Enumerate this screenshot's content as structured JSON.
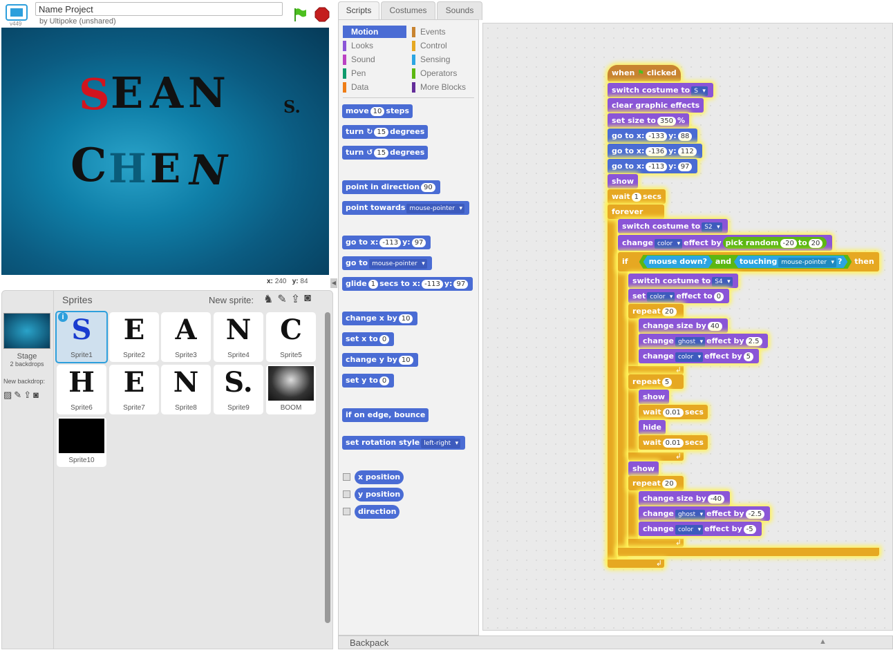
{
  "header": {
    "version": "v449",
    "project_title": "Name Project",
    "author": "by Ultipoke (unshared)"
  },
  "stage": {
    "mouse_x_label": "x:",
    "mouse_x": "240",
    "mouse_y_label": "y:",
    "mouse_y": "84",
    "letters": [
      "S",
      "E",
      "A",
      "N",
      "S.",
      "C",
      "H",
      "E",
      "N"
    ]
  },
  "sprites_pane": {
    "header": "Sprites",
    "new_sprite": "New sprite:",
    "stage_label": "Stage",
    "stage_sub": "2 backdrops",
    "new_backdrop": "New backdrop:",
    "tiles": [
      {
        "glyph": "S",
        "label": "Sprite1"
      },
      {
        "glyph": "E",
        "label": "Sprite2"
      },
      {
        "glyph": "A",
        "label": "Sprite3"
      },
      {
        "glyph": "N",
        "label": "Sprite4"
      },
      {
        "glyph": "C",
        "label": "Sprite5"
      },
      {
        "glyph": "H",
        "label": "Sprite6"
      },
      {
        "glyph": "E",
        "label": "Sprite7"
      },
      {
        "glyph": "N",
        "label": "Sprite8"
      },
      {
        "glyph": "S.",
        "label": "Sprite9"
      },
      {
        "glyph": "",
        "label": "BOOM"
      },
      {
        "glyph": "",
        "label": "Sprite10"
      }
    ]
  },
  "tabs": [
    "Scripts",
    "Costumes",
    "Sounds"
  ],
  "categories": [
    {
      "label": "Motion",
      "color": "#4a6cd4"
    },
    {
      "label": "Events",
      "color": "#c88330"
    },
    {
      "label": "Looks",
      "color": "#8a55d7"
    },
    {
      "label": "Control",
      "color": "#e6a822"
    },
    {
      "label": "Sound",
      "color": "#bb42c3"
    },
    {
      "label": "Sensing",
      "color": "#2ca5e2"
    },
    {
      "label": "Pen",
      "color": "#0e9a6c"
    },
    {
      "label": "Operators",
      "color": "#5cb712"
    },
    {
      "label": "Data",
      "color": "#ee7d16"
    },
    {
      "label": "More Blocks",
      "color": "#632d99"
    }
  ],
  "palette": {
    "move": [
      "move",
      "10",
      "steps"
    ],
    "turn_cw": [
      "turn",
      "↻",
      "15",
      "degrees"
    ],
    "turn_ccw": [
      "turn",
      "↺",
      "15",
      "degrees"
    ],
    "point_dir": [
      "point in direction",
      "90"
    ],
    "point_towards": [
      "point towards",
      "mouse-pointer"
    ],
    "goto_xy": [
      "go to x:",
      "-113",
      "y:",
      "97"
    ],
    "goto": [
      "go to",
      "mouse-pointer"
    ],
    "glide": [
      "glide",
      "1",
      "secs to x:",
      "-113",
      "y:",
      "97"
    ],
    "change_x": [
      "change x by",
      "10"
    ],
    "set_x": [
      "set x to",
      "0"
    ],
    "change_y": [
      "change y by",
      "10"
    ],
    "set_y": [
      "set y to",
      "0"
    ],
    "bounce": "if on edge, bounce",
    "rot_style": [
      "set rotation style",
      "left-right"
    ],
    "reporters": [
      "x position",
      "y position",
      "direction"
    ]
  },
  "script": {
    "hat": [
      "when",
      "clicked"
    ],
    "b1": [
      "switch costume to",
      "S"
    ],
    "b2": "clear graphic effects",
    "b3": [
      "set size to",
      "350",
      "%"
    ],
    "b4": [
      "go to x:",
      "-133",
      "y:",
      "88"
    ],
    "b5": [
      "go to x:",
      "-136",
      "y:",
      "112"
    ],
    "b6": [
      "go to x:",
      "-113",
      "y:",
      "97"
    ],
    "b7": "show",
    "b8": [
      "wait",
      "1",
      "secs"
    ],
    "forever": "forever",
    "f1": [
      "switch costume to",
      "S2"
    ],
    "f2": [
      "change",
      "color",
      "effect by",
      "pick random",
      "-20",
      "to",
      "20"
    ],
    "if": [
      "if",
      "mouse down?",
      "and",
      "touching",
      "mouse-pointer",
      "?",
      "then"
    ],
    "i1": [
      "switch costume to",
      "S4"
    ],
    "i2": [
      "set",
      "color",
      "effect to",
      "0"
    ],
    "rep1": [
      "repeat",
      "20"
    ],
    "r1a": [
      "change size by",
      "40"
    ],
    "r1b": [
      "change",
      "ghost",
      "effect by",
      "2.5"
    ],
    "r1c": [
      "change",
      "color",
      "effect by",
      "5"
    ],
    "rep2": [
      "repeat",
      "5"
    ],
    "r2a": "show",
    "r2b": [
      "wait",
      "0.01",
      "secs"
    ],
    "r2c": "hide",
    "r2d": [
      "wait",
      "0.01",
      "secs"
    ],
    "show2": "show",
    "rep3": [
      "repeat",
      "20"
    ],
    "r3a": [
      "change size by",
      "-40"
    ],
    "r3b": [
      "change",
      "ghost",
      "effect by",
      "-2.5"
    ],
    "r3c": [
      "change",
      "color",
      "effect by",
      "-5"
    ]
  },
  "backpack": "Backpack"
}
